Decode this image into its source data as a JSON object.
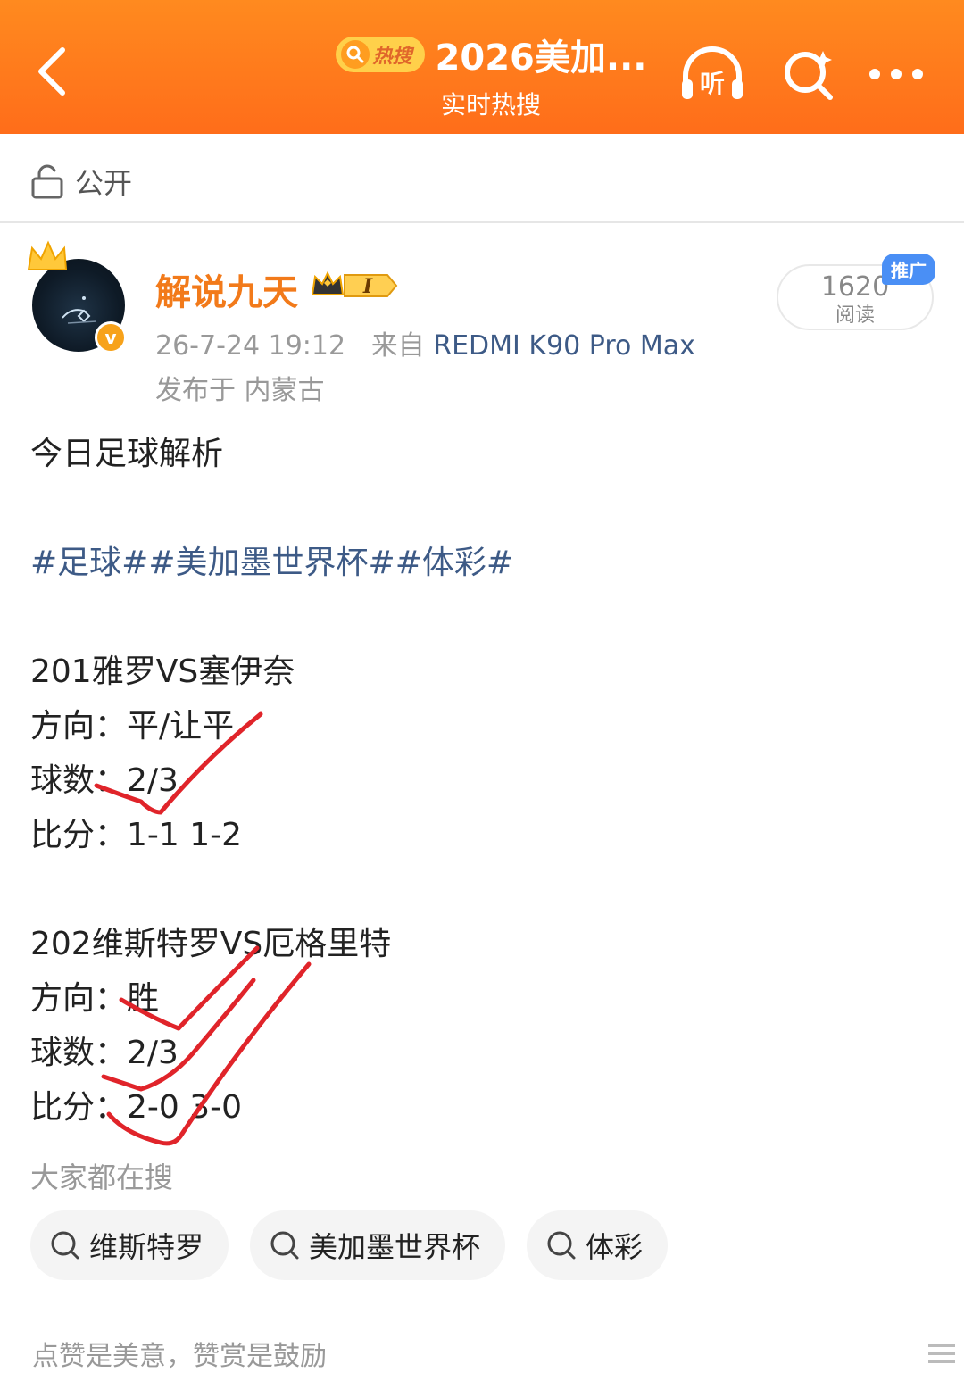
{
  "header": {
    "hot_badge": "热搜",
    "title": "2026美加...",
    "subtitle": "实时热搜",
    "listen_label": "听"
  },
  "post_meta": {
    "visibility": "公开",
    "username": "解说九天",
    "vip_level": "I",
    "time": "26-7-24 19:12",
    "from_prefix": "来自",
    "device": "REDMI K90 Pro Max",
    "location": "发布于 内蒙古",
    "reads_count": "1620",
    "reads_label": "阅读",
    "promo_badge": "推广"
  },
  "content": {
    "title": "今日足球解析",
    "tags": [
      "#足球#",
      "#美加墨世界杯#",
      "#体彩#"
    ],
    "match1": {
      "header": "201雅罗VS塞伊奈",
      "direction": "方向：平/让平",
      "goals": "球数：2/3",
      "score": "比分：1-1 1-2"
    },
    "match2": {
      "header": "202维斯特罗VS厄格里特",
      "direction": "方向：胜",
      "goals": "球数：2/3",
      "score": "比分：2-0 3-0"
    }
  },
  "related": {
    "title": "大家都在搜",
    "chips": [
      "维斯特罗",
      "美加墨世界杯",
      "体彩"
    ]
  },
  "footer": {
    "text": "点赞是美意，赞赏是鼓励"
  },
  "colors": {
    "header_orange": "#ff7a1a",
    "username_orange": "#f27a1a",
    "link_blue": "#3d5a86",
    "check_red": "#e0242a"
  }
}
